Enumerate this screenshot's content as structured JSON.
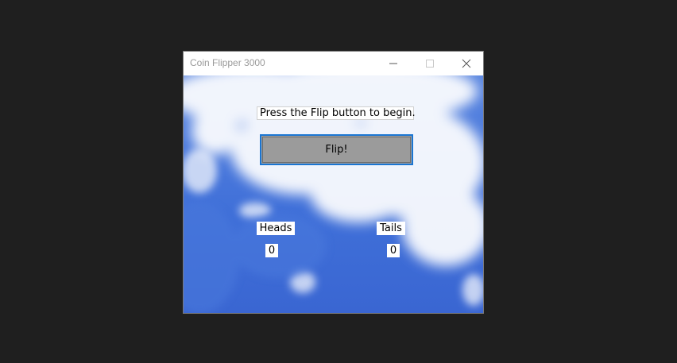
{
  "window": {
    "title": "Coin Flipper 3000"
  },
  "titlebar_icons": {
    "minimize": "minimize-icon",
    "maximize": "maximize-icon",
    "close": "close-icon"
  },
  "status_text": "Press the Flip button to begin.",
  "flip_button_label": "Flip!",
  "heads": {
    "label": "Heads",
    "count": "0"
  },
  "tails": {
    "label": "Tails",
    "count": "0"
  },
  "colors": {
    "accent_border": "#1a75d2",
    "button_face": "#9b9b9b",
    "sky_blue": "#3f6fd8"
  }
}
